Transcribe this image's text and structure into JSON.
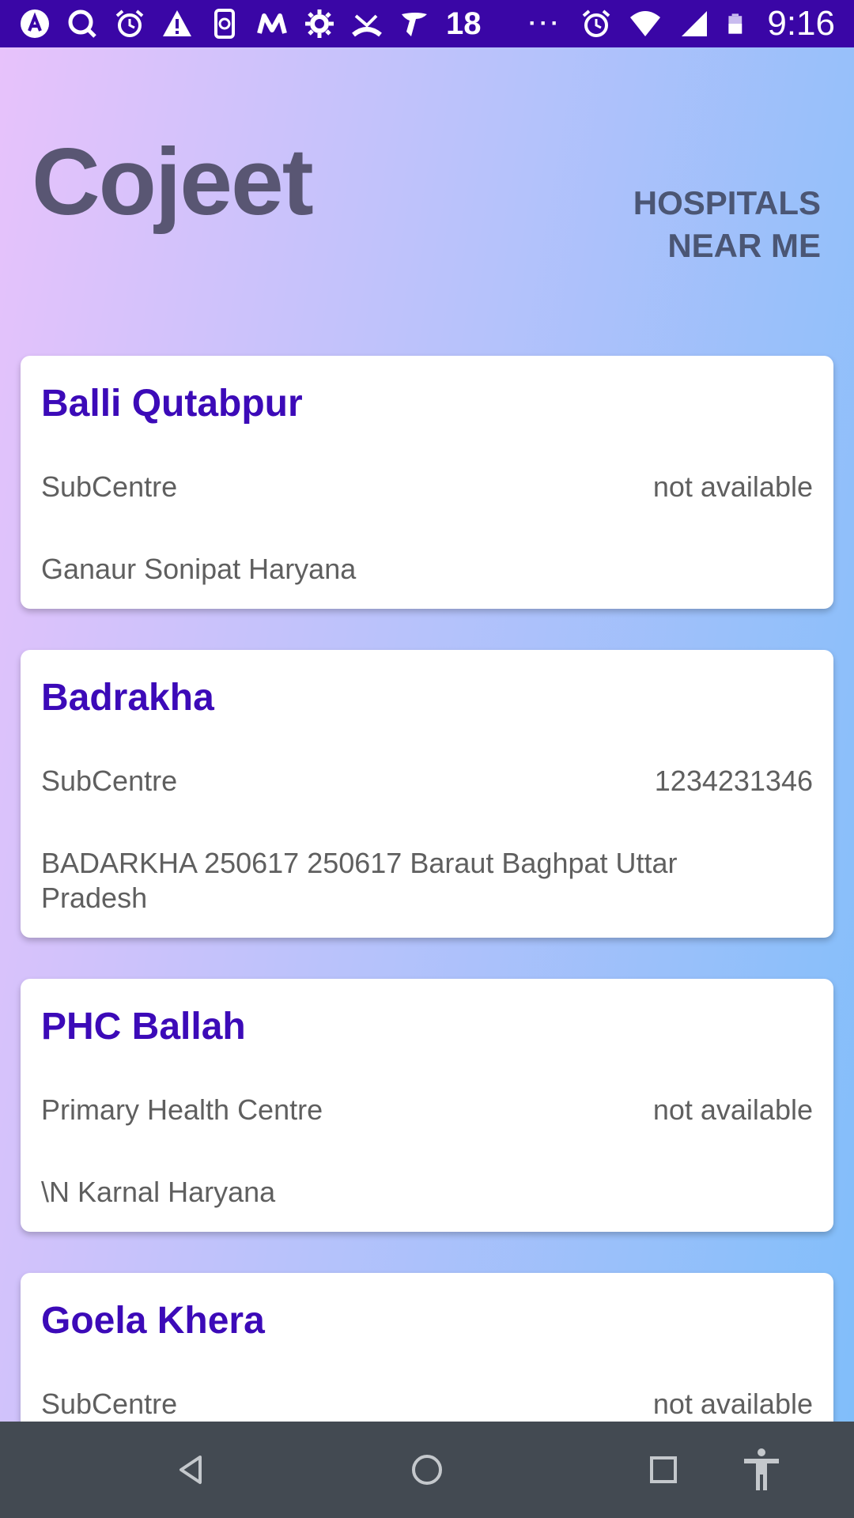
{
  "status_bar": {
    "notification_count": "18",
    "overflow": "···",
    "time": "9:16",
    "icons": [
      "app-a-icon",
      "search-icon",
      "alarm-icon",
      "warning-icon",
      "phone-app-icon",
      "myntra-icon",
      "settings-icon",
      "call-missed-icon",
      "airtel-icon",
      "alarm-icon",
      "wifi-icon",
      "signal-icon",
      "battery-icon"
    ]
  },
  "header": {
    "app_title": "Cojeet",
    "nearby_link": "HOSPITALS NEAR ME"
  },
  "hospitals": [
    {
      "name": "Balli Qutabpur",
      "type": "SubCentre",
      "phone": "not available",
      "address": "Ganaur Sonipat Haryana"
    },
    {
      "name": "Badrakha",
      "type": "SubCentre",
      "phone": "1234231346",
      "address": "BADARKHA 250617 250617 Baraut Baghpat Uttar Pradesh"
    },
    {
      "name": "PHC Ballah",
      "type": "Primary Health Centre",
      "phone": "not available",
      "address": "\\N Karnal Haryana"
    },
    {
      "name": "Goela Khera",
      "type": "SubCentre",
      "phone": "not available",
      "address": ""
    }
  ],
  "nav_bar": {
    "icons": [
      "back-icon",
      "home-icon",
      "recents-icon",
      "accessibility-icon"
    ]
  },
  "colors": {
    "status_bar": "#3a06a6",
    "card_title": "#3c0ab8",
    "app_title": "#595673",
    "nav_bar": "#434a52"
  }
}
